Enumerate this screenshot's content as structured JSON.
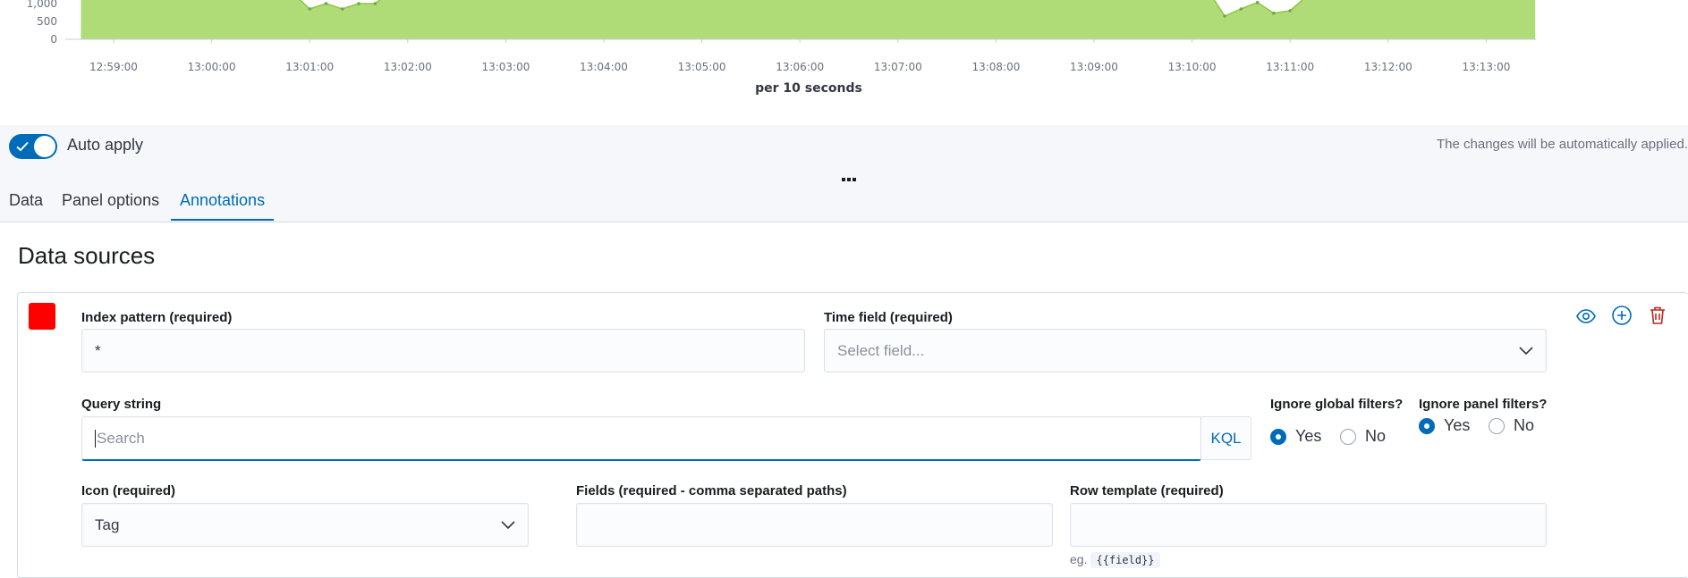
{
  "chart_data": {
    "type": "area",
    "y_ticks": [
      "1,000",
      "500",
      "0"
    ],
    "x_ticks": [
      "12:59:00",
      "13:00:00",
      "13:01:00",
      "13:02:00",
      "13:03:00",
      "13:04:00",
      "13:05:00",
      "13:06:00",
      "13:07:00",
      "13:08:00",
      "13:09:00",
      "13:10:00",
      "13:11:00",
      "13:12:00",
      "13:13:00"
    ],
    "xlabel": "per 10 seconds",
    "fill_color": "#b0dc78",
    "line_color": "#54b399",
    "ylim": [
      0,
      1100
    ],
    "series": [
      {
        "points": [
          [
            "12:58:40",
            2000
          ],
          [
            "13:00:40",
            2000
          ],
          [
            "13:00:50",
            1280
          ],
          [
            "13:01:00",
            850
          ],
          [
            "13:01:10",
            1000
          ],
          [
            "13:01:20",
            850
          ],
          [
            "13:01:30",
            1000
          ],
          [
            "13:01:40",
            1000
          ],
          [
            "13:01:50",
            2000
          ],
          [
            "13:10:10",
            2000
          ],
          [
            "13:10:20",
            650
          ],
          [
            "13:10:30",
            850
          ],
          [
            "13:10:40",
            1030
          ],
          [
            "13:10:50",
            730
          ],
          [
            "13:11:00",
            800
          ],
          [
            "13:11:10",
            1200
          ],
          [
            "13:11:20",
            2000
          ],
          [
            "13:13:30",
            2000
          ]
        ]
      }
    ]
  },
  "toolbar": {
    "auto_apply_label": "Auto apply",
    "auto_apply_note": "The changes will be automatically applied."
  },
  "tabs": [
    {
      "label": "Data",
      "active": false
    },
    {
      "label": "Panel options",
      "active": false
    },
    {
      "label": "Annotations",
      "active": true
    }
  ],
  "section": {
    "title": "Data sources"
  },
  "annotation": {
    "swatch_color": "#ff0000",
    "index_pattern": {
      "label": "Index pattern (required)",
      "value": "*"
    },
    "time_field": {
      "label": "Time field (required)",
      "placeholder": "Select field..."
    },
    "query_string": {
      "label": "Query string",
      "placeholder": "Search",
      "language": "KQL"
    },
    "ignore_global": {
      "label": "Ignore global filters?",
      "yes": "Yes",
      "no": "No",
      "selected": "Yes"
    },
    "ignore_panel": {
      "label": "Ignore panel filters?",
      "yes": "Yes",
      "no": "No",
      "selected": "Yes"
    },
    "icon": {
      "label": "Icon (required)",
      "value": "Tag"
    },
    "fields": {
      "label": "Fields (required - comma separated paths)",
      "value": ""
    },
    "row_template": {
      "label": "Row template (required)",
      "value": "",
      "hint_prefix": "eg.",
      "hint_code": "{{field}}"
    }
  },
  "icons": {
    "toggle": "eye-icon",
    "add": "plus-circle-icon",
    "delete": "trash-icon"
  }
}
